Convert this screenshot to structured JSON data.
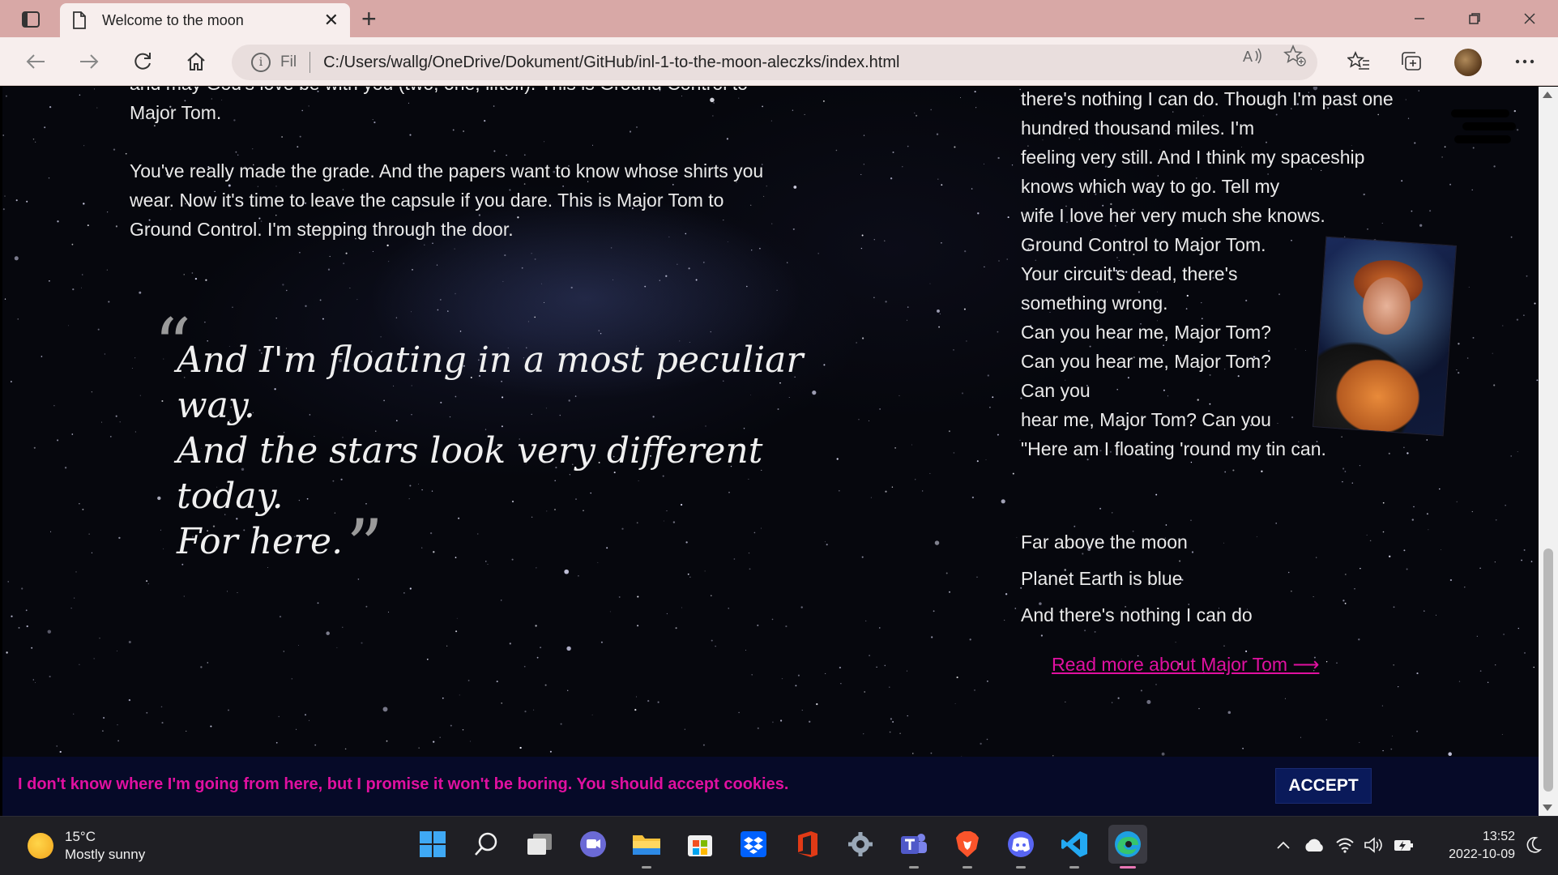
{
  "browser": {
    "tab_title": "Welcome to the moon",
    "new_tab_symbol": "+",
    "close_tab_symbol": "✕",
    "site_info_label": "Fil",
    "url": "C:/Users/wallg/OneDrive/Dokument/GitHub/inl-1-to-the-moon-aleczks/index.html"
  },
  "page": {
    "left_partial_line": "and may God's love be with you (two, one, liftoff). This is Ground Control to Major Tom.",
    "left_paragraph": "You've really made the grade. And the papers want to know whose shirts you wear. Now it's time to leave the capsule if you dare. This is Major Tom to Ground Control. I'm stepping through the door.",
    "quote": {
      "open_mark": "“",
      "line1": "And I'm floating in a most peculiar way.",
      "line2": "And the stars look very different today.",
      "line3": "For here.",
      "close_mark": "”"
    },
    "right_lyrics": [
      "there's nothing I can do. Though I'm past one",
      "hundred thousand miles. I'm",
      "feeling very still. And I think my spaceship",
      "knows which way to go. Tell my",
      "wife I love her very much she knows.",
      "Ground Control to Major Tom.",
      "Your circuit's dead, there's",
      "something wrong.",
      "Can you hear me, Major Tom?",
      "Can you hear me, Major Tom?",
      "Can you",
      "hear me, Major Tom? Can you",
      "\"Here am I floating 'round my tin can."
    ],
    "lyrics_block2": [
      "Far above the moon",
      "Planet Earth is blue",
      "And there's nothing I can do"
    ],
    "read_more": "Read more about Major Tom ⟶",
    "cookie_text": "I don't know where I'm going from here, but I promise it won't be boring. You should accept cookies.",
    "accept_label": "ACCEPT"
  },
  "taskbar": {
    "temperature": "15°C",
    "weather": "Mostly sunny",
    "time": "13:52",
    "date": "2022-10-09"
  },
  "colors": {
    "accent_pink": "#e010a0",
    "cookie_bar_bg": "#060a28",
    "accept_bg": "#0a1a5a",
    "titlebar": "#d8a8a6"
  }
}
